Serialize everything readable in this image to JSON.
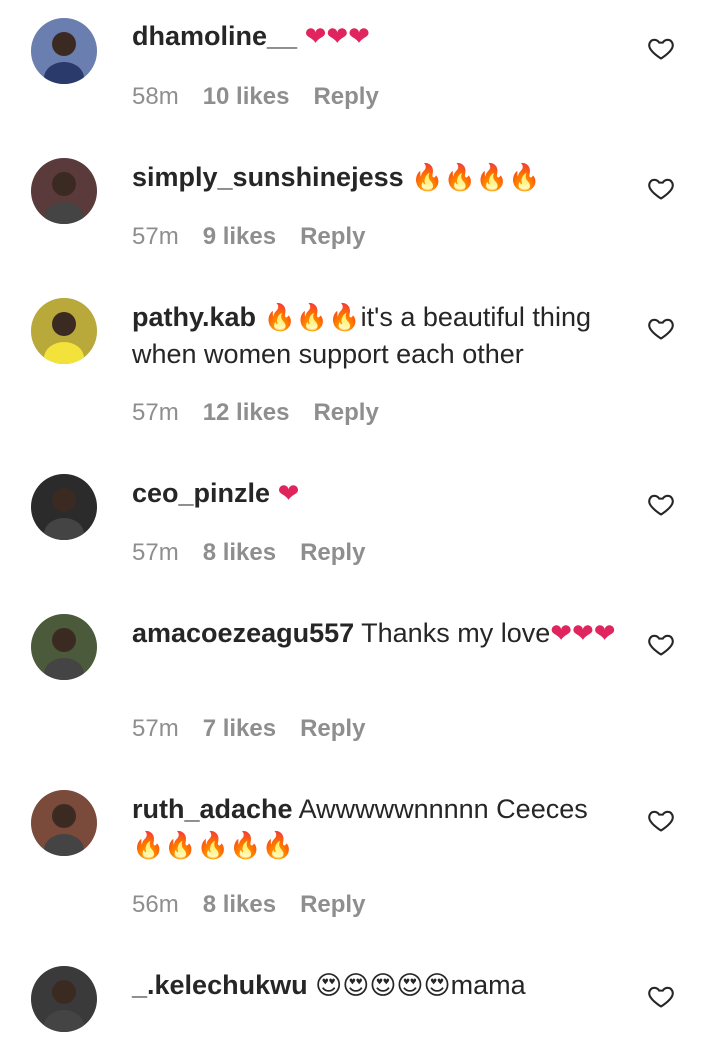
{
  "comments": [
    {
      "username": "dhamoline__",
      "text": "",
      "emoji": "❤❤❤",
      "emoji_kind": "heart",
      "time": "58m",
      "likes": "10 likes",
      "reply": "Reply",
      "avatar_icon": "user-avatar-icon",
      "avatar_color": "#6a7fb0"
    },
    {
      "username": "simply_sunshinejess",
      "text": "",
      "emoji": "🔥🔥🔥🔥",
      "emoji_kind": "fire",
      "time": "57m",
      "likes": "9 likes",
      "reply": "Reply",
      "avatar_icon": "user-avatar-icon",
      "avatar_color": "#5a3a3a"
    },
    {
      "username": "pathy.kab",
      "text": "it's a beautiful thing when women support each other",
      "emoji": "🔥🔥🔥",
      "emoji_kind": "fire",
      "emoji_first": true,
      "time": "57m",
      "likes": "12 likes",
      "reply": "Reply",
      "avatar_icon": "user-avatar-icon",
      "avatar_color": "#b8a93a"
    },
    {
      "username": "ceo_pinzle",
      "text": "",
      "emoji": "❤",
      "emoji_kind": "heart",
      "time": "57m",
      "likes": "8 likes",
      "reply": "Reply",
      "avatar_icon": "user-avatar-icon",
      "avatar_color": "#2b2b2b"
    },
    {
      "username": "amacoezeagu557",
      "text": "Thanks my love",
      "emoji": "❤❤❤",
      "emoji_kind": "heart",
      "time": "57m",
      "likes": "7 likes",
      "reply": "Reply",
      "avatar_icon": "user-avatar-icon",
      "avatar_color": "#4a5a3a"
    },
    {
      "username": "ruth_adache",
      "text": "Awwwwwnnnnn Ceeces",
      "emoji": "🔥🔥🔥🔥🔥",
      "emoji_kind": "fire",
      "time": "56m",
      "likes": "8 likes",
      "reply": "Reply",
      "avatar_icon": "user-avatar-icon",
      "avatar_color": "#7a4a3a"
    },
    {
      "username": "_.kelechukwu",
      "text": "mama",
      "emoji": "😍😍😍😍😍",
      "emoji_kind": "face",
      "emoji_first": true,
      "time": "",
      "likes": "",
      "reply": "",
      "avatar_icon": "user-avatar-icon",
      "avatar_color": "#3a3a3a"
    }
  ],
  "icons": {
    "like": "heart-outline-icon"
  },
  "colors": {
    "text": "#262626",
    "meta": "#8e8e8e",
    "heart": "#e0245e",
    "fire": "#f48a1a"
  }
}
